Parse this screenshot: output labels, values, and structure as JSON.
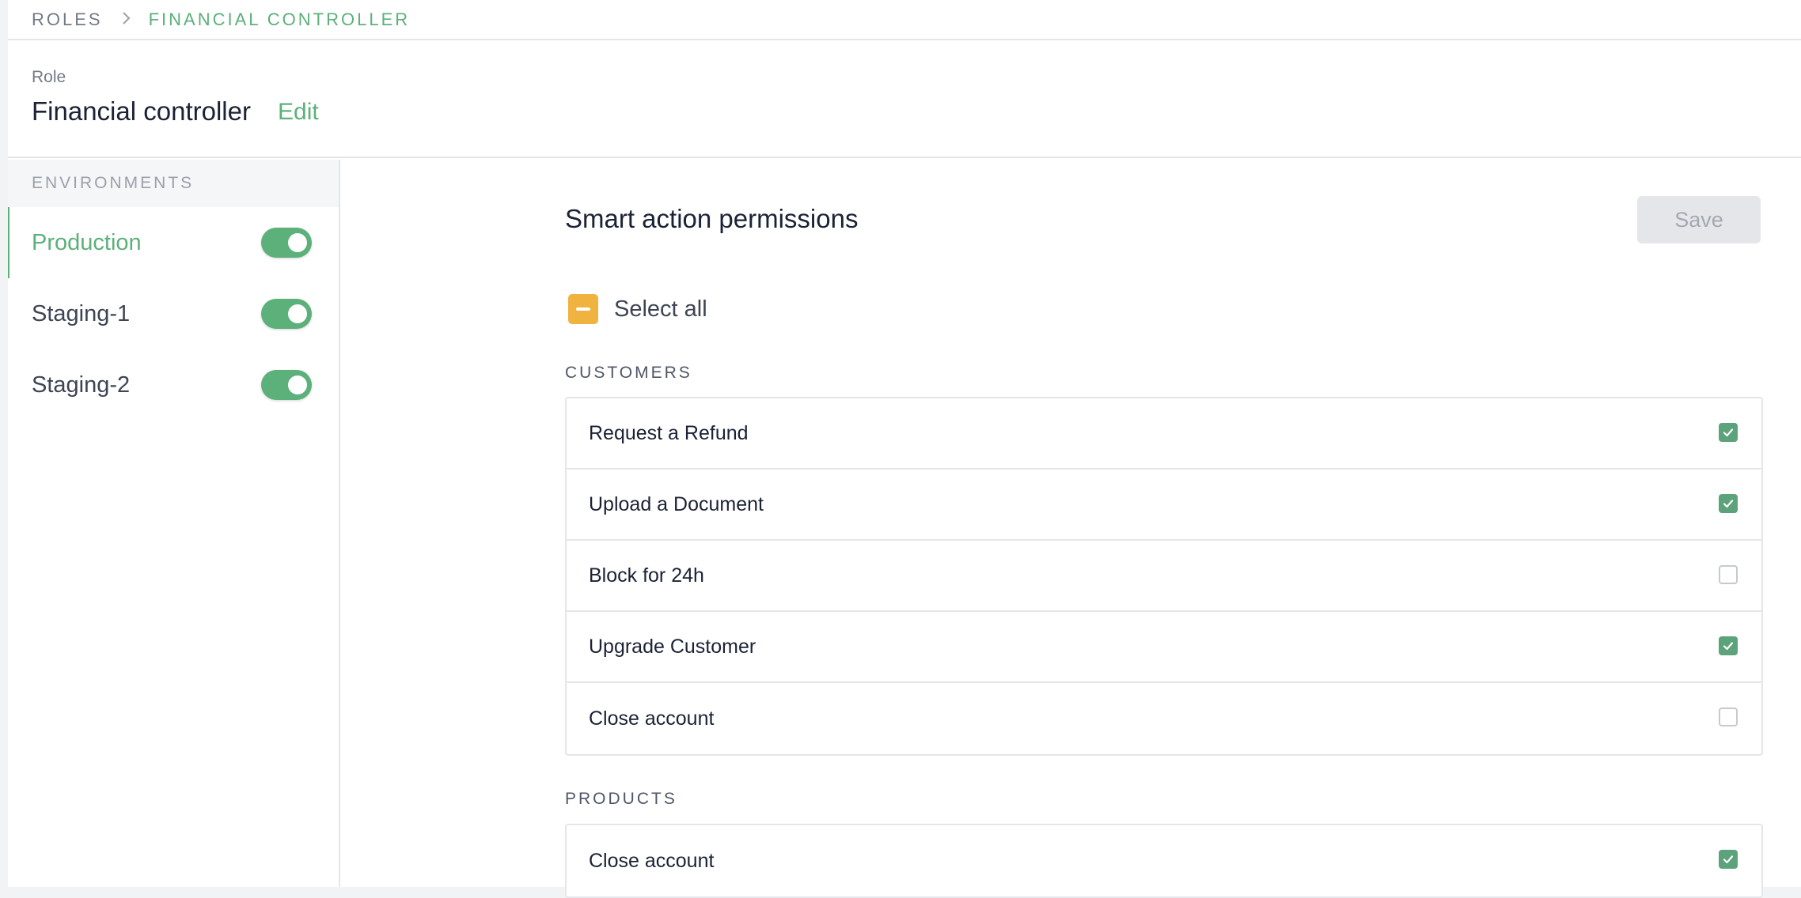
{
  "breadcrumb": {
    "root": "ROLES",
    "separator": "›",
    "current": "FINANCIAL CONTROLLER"
  },
  "role": {
    "caption": "Role",
    "name": "Financial controller",
    "edit_label": "Edit"
  },
  "sidebar": {
    "heading": "ENVIRONMENTS",
    "environments": [
      {
        "label": "Production",
        "enabled": true,
        "active": true
      },
      {
        "label": "Staging-1",
        "enabled": true,
        "active": false
      },
      {
        "label": "Staging-2",
        "enabled": true,
        "active": false
      }
    ]
  },
  "main": {
    "title": "Smart action permissions",
    "save_label": "Save",
    "save_disabled": true,
    "select_all_label": "Select all",
    "select_all_state": "indeterminate",
    "groups": [
      {
        "title": "CUSTOMERS",
        "actions": [
          {
            "label": "Request a Refund",
            "checked": true
          },
          {
            "label": "Upload a Document",
            "checked": true
          },
          {
            "label": "Block for 24h",
            "checked": false
          },
          {
            "label": "Upgrade Customer",
            "checked": true
          },
          {
            "label": "Close account",
            "checked": false
          }
        ]
      },
      {
        "title": "PRODUCTS",
        "actions": [
          {
            "label": "Close account",
            "checked": true
          }
        ]
      }
    ]
  },
  "colors": {
    "accent_green": "#5cb07a",
    "checkbox_green": "#5ca37c",
    "indeterminate_orange": "#f1b33f",
    "border_gray": "#e4e6e9"
  },
  "icons": {
    "breadcrumb_separator": "chevron-right-icon",
    "select_all": "minus-icon",
    "checked": "checkmark-icon"
  }
}
